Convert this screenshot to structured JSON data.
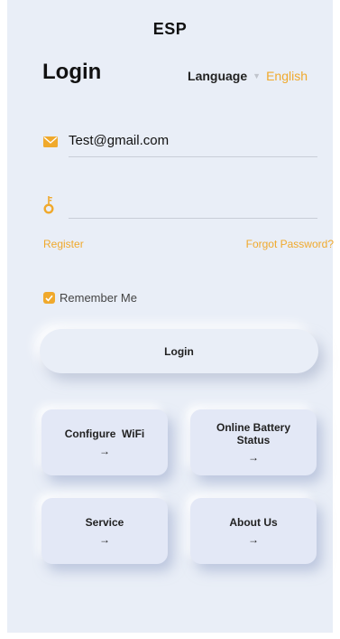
{
  "header": {
    "title": "ESP"
  },
  "login": {
    "heading": "Login",
    "language_label": "Language",
    "language_value": "English",
    "email_value": "Test@gmail.com",
    "password_value": "",
    "register_link": "Register",
    "forgot_link": "Forgot Password?",
    "remember_label": "Remember Me",
    "remember_checked": true,
    "login_button": "Login"
  },
  "tiles": [
    {
      "label": "Configure  WiFi",
      "arrow": "→"
    },
    {
      "label": "Online Battery Status",
      "arrow": "→"
    },
    {
      "label": "Service",
      "arrow": "→"
    },
    {
      "label": "About Us",
      "arrow": "→"
    }
  ],
  "colors": {
    "accent": "#f0a92c",
    "background": "#e9eef7",
    "tile": "#e3e8f6"
  },
  "icons": {
    "email": "mail-icon",
    "password": "key-icon",
    "language": "caret-down-icon",
    "remember": "checkbox-checked-icon"
  }
}
